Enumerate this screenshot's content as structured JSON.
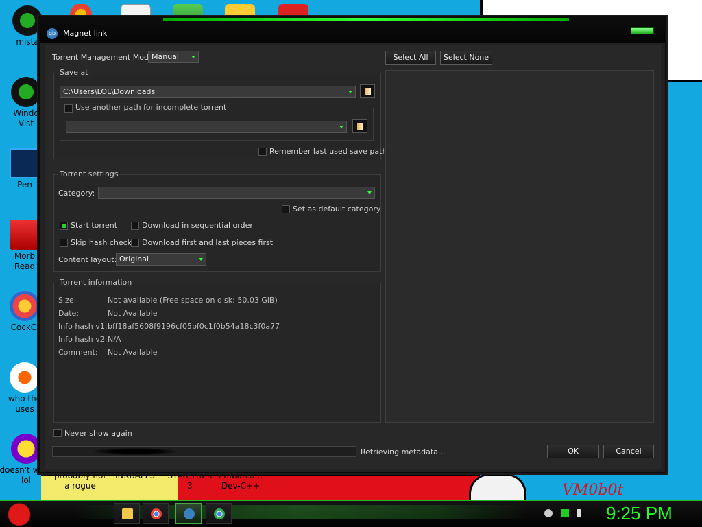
{
  "desktop": {
    "icons": [
      {
        "label": "mista"
      },
      {
        "label": "Windo\nVist"
      },
      {
        "label": "Pen"
      },
      {
        "label": "Morb\nRead"
      },
      {
        "label": "CockCl"
      },
      {
        "label": "who the\nuses"
      },
      {
        "label": "doesn't work\nlol"
      }
    ],
    "bottom_labels": [
      "probably not\na rogue",
      "INKBALLS",
      "STAR TREK\n3",
      "Embarca...\nDev-C++"
    ],
    "watermark": "VM0b0t"
  },
  "dialog": {
    "title": "Magnet link",
    "app_icon_text": "qb",
    "management_mode_label": "Torrent Management Mode:",
    "management_mode_value": "Manual",
    "select_all": "Select All",
    "select_none": "Select None",
    "save_at": {
      "title": "Save at",
      "path": "C:\\Users\\LOL\\Downloads",
      "use_another_path_label": "Use another path for incomplete torrent",
      "incomplete_path": "",
      "remember_label": "Remember last used save path"
    },
    "torrent_settings": {
      "title": "Torrent settings",
      "category_label": "Category:",
      "category_value": "",
      "set_default_label": "Set as default category",
      "start_torrent_label": "Start torrent",
      "sequential_label": "Download in sequential order",
      "skip_hash_label": "Skip hash check",
      "first_last_label": "Download first and last pieces first",
      "content_layout_label": "Content layout:",
      "content_layout_value": "Original"
    },
    "torrent_info": {
      "title": "Torrent information",
      "rows": [
        {
          "key": "Size:",
          "value": "Not available (Free space on disk: 50.03 GiB)"
        },
        {
          "key": "Date:",
          "value": "Not Available"
        },
        {
          "key": "Info hash v1:",
          "value": "bff18af5608f9196cf05bf0c1f0b54a18c3f0a77"
        },
        {
          "key": "Info hash v2:",
          "value": "N/A"
        },
        {
          "key": "Comment:",
          "value": "Not Available"
        }
      ]
    },
    "never_show_label": "Never show again",
    "status_text": "Retrieving metadata...",
    "ok_label": "OK",
    "cancel_label": "Cancel",
    "checkbox_states": {
      "use_another_path": false,
      "remember": false,
      "set_default": false,
      "start_torrent": true,
      "sequential": false,
      "skip_hash": false,
      "first_last": false,
      "never_show": false
    }
  },
  "taskbar": {
    "items": [
      "folder-icon",
      "chrome-icon",
      "qbittorrent-icon",
      "chrome-alt-icon"
    ],
    "clock": "9:25 PM"
  },
  "colors": {
    "accent": "#33ff33",
    "dialog_bg": "#282828",
    "desktop_bg": "#13a8e0"
  }
}
